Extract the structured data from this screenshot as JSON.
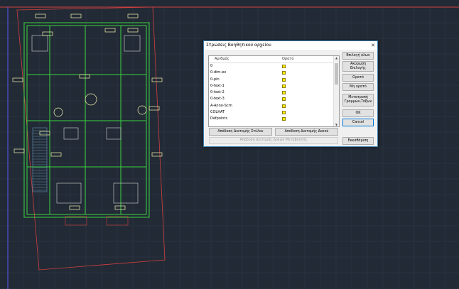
{
  "dialog": {
    "title": "Στρώσεις Βοηθητικού αρχείου",
    "close_glyph": "✕",
    "columns": {
      "number": "Αριθμός",
      "visible": "Ορατό"
    },
    "layers": [
      {
        "name": "0",
        "color": "#ffef00"
      },
      {
        "name": "0-dim-ex",
        "color": "#ffef00"
      },
      {
        "name": "0-pin",
        "color": "#ffef00"
      },
      {
        "name": "0-text-1",
        "color": "#ffef00"
      },
      {
        "name": "0-text-2",
        "color": "#ffef00"
      },
      {
        "name": "0-text-3",
        "color": "#ffef00"
      },
      {
        "name": "A-Anno-Scrn",
        "color": "#ffef00"
      },
      {
        "name": "COLHAT",
        "color": "#ffef00"
      },
      {
        "name": "Defpoints",
        "color": "#ffef00"
      }
    ],
    "buttons": {
      "select_all": "Επιλογή όλων",
      "deselect": "Ακύρωση Επιλογής",
      "visible": "Ορατό",
      "not_visible": "Μη ορατό",
      "convert": "Μετατροπή Γραμμών,Τόξων",
      "ok": "OK",
      "cancel": "Cancel",
      "assign_column": "Απόδοση Διατομής Στύλου",
      "assign_beam": "Απόδοση Διατομής Δοκού",
      "assign_var_beam": "Απόδοση Διατομής Δοκών Μεταβλητής",
      "clear": "Εκκαθάριση"
    }
  },
  "colors": {
    "canvas_bg": "#222a35",
    "plan_line": "#39d43e",
    "plan_accent": "#f2f2b0",
    "border_red": "#d24040",
    "axis_blue": "#5b5bff"
  }
}
